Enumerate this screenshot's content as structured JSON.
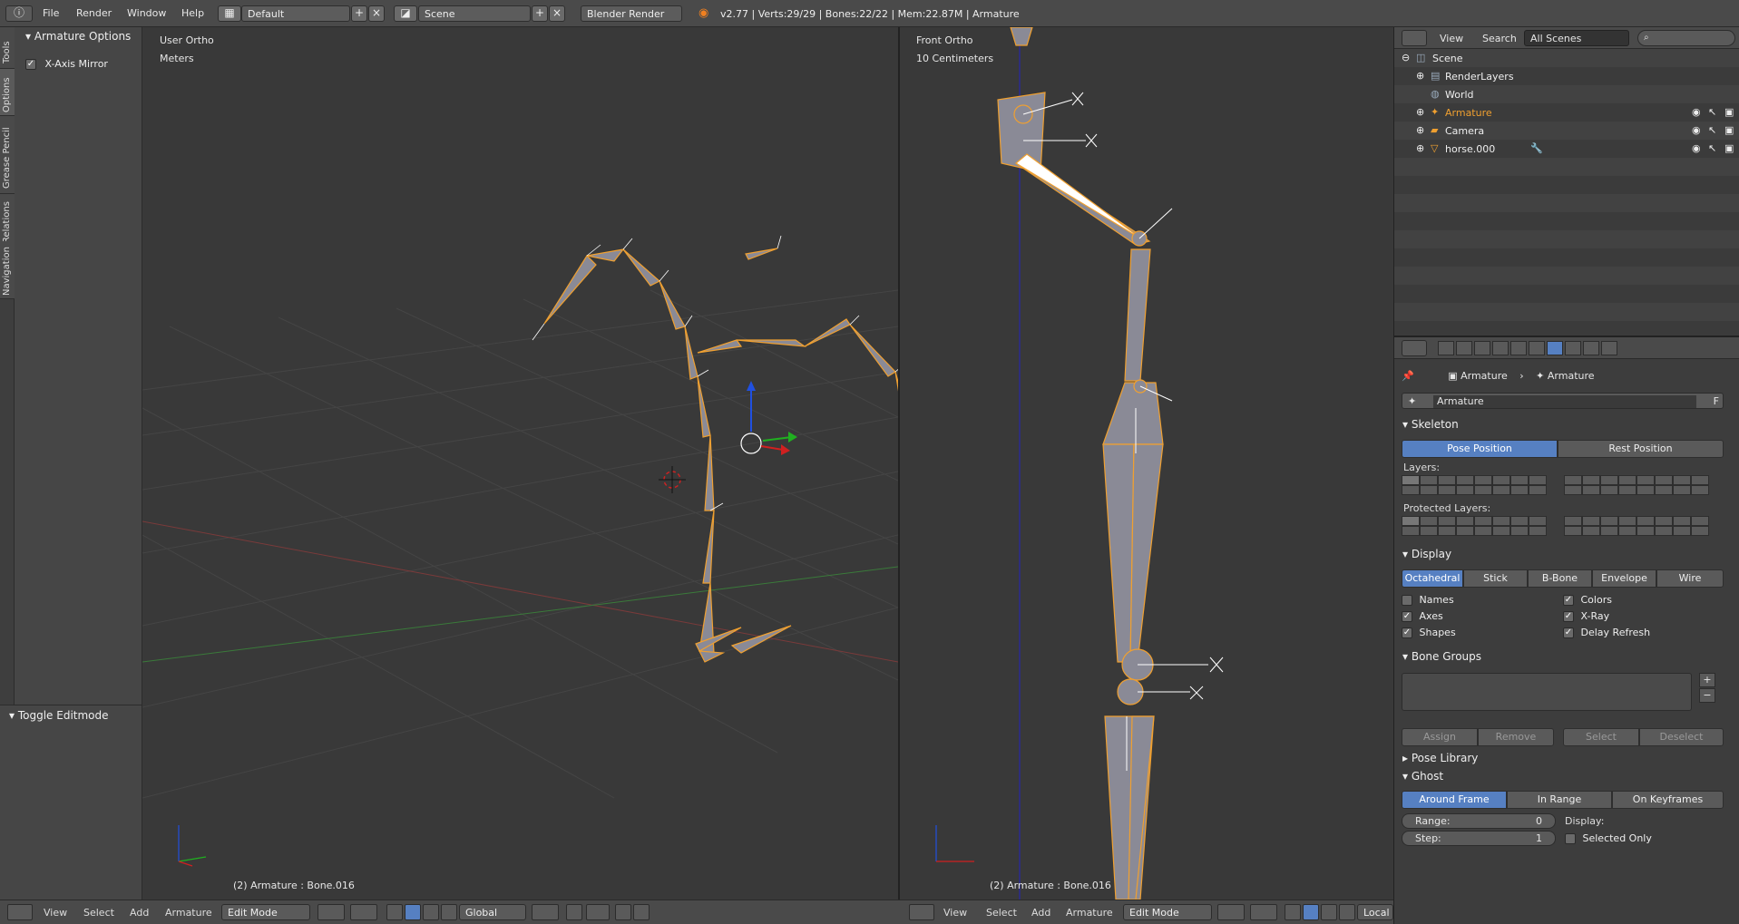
{
  "topbar": {
    "menus": [
      "File",
      "Render",
      "Window",
      "Help"
    ],
    "screen_layout": "Default",
    "scene": "Scene",
    "engine": "Blender Render",
    "info": "v2.77 | Verts:29/29 | Bones:22/22 | Mem:22.87M | Armature"
  },
  "tool_tabs": [
    "Tools",
    "Options",
    "Grease Pencil",
    "Relations",
    "Navigation"
  ],
  "tool_panel": {
    "title": "Armature Options",
    "xmirror": "X-Axis Mirror",
    "op_title": "Toggle Editmode"
  },
  "viewport_left": {
    "view": "User Ortho",
    "units": "Meters",
    "status": "(2) Armature : Bone.016"
  },
  "viewport_right": {
    "view": "Front Ortho",
    "units": "10 Centimeters",
    "status": "(2) Armature : Bone.016"
  },
  "header_left": {
    "menus": [
      "View",
      "Select",
      "Add",
      "Armature"
    ],
    "mode": "Edit Mode",
    "orientation": "Global"
  },
  "header_right": {
    "menus": [
      "View",
      "Select",
      "Add",
      "Armature"
    ],
    "mode": "Edit Mode",
    "orientation": "Local"
  },
  "outliner": {
    "menus": [
      "View",
      "Search"
    ],
    "filter": "All Scenes",
    "rows": [
      "Scene",
      "RenderLayers",
      "World",
      "Armature",
      "Camera",
      "horse.000"
    ]
  },
  "properties": {
    "breadcrumb": [
      "Armature",
      "Armature"
    ],
    "name": "Armature",
    "fake_user": "F",
    "skeleton": {
      "title": "Skeleton",
      "pose": "Pose Position",
      "rest": "Rest Position",
      "layers": "Layers:",
      "protected": "Protected Layers:"
    },
    "display": {
      "title": "Display",
      "types": [
        "Octahedral",
        "Stick",
        "B-Bone",
        "Envelope",
        "Wire"
      ],
      "names": "Names",
      "axes": "Axes",
      "shapes": "Shapes",
      "colors": "Colors",
      "xray": "X-Ray",
      "delay": "Delay Refresh"
    },
    "bone_groups": {
      "title": "Bone Groups",
      "assign": "Assign",
      "remove": "Remove",
      "select": "Select",
      "deselect": "Deselect"
    },
    "pose_library": "Pose Library",
    "ghost": {
      "title": "Ghost",
      "types": [
        "Around Frame",
        "In Range",
        "On Keyframes"
      ],
      "range_label": "Range:",
      "range_value": "0",
      "step_label": "Step:",
      "step_value": "1",
      "display_label": "Display:",
      "selected_only": "Selected Only"
    }
  },
  "colors": {
    "accent": "#5680c2",
    "bone": "#f0a030"
  }
}
